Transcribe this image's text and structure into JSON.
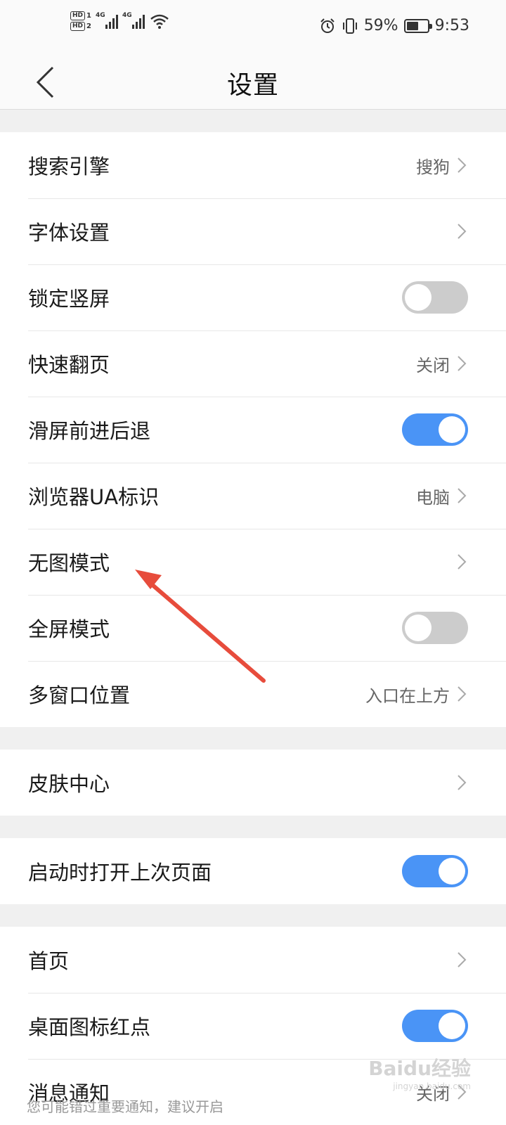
{
  "status_bar": {
    "hd1": "HD",
    "hd1_index": "1",
    "hd2": "HD",
    "hd2_index": "2",
    "network1": "4G",
    "network2": "4G",
    "battery_percent": "59%",
    "battery_level": 0.59,
    "time": "9:53",
    "icons": [
      "hd-icon",
      "signal-icon",
      "wifi-icon",
      "alarm-icon",
      "vibrate-icon",
      "battery-icon"
    ]
  },
  "nav": {
    "title": "设置",
    "back_icon": "chevron-left-icon"
  },
  "group1": [
    {
      "label": "搜索引擎",
      "type": "value",
      "value": "搜狗"
    },
    {
      "label": "字体设置",
      "type": "link"
    },
    {
      "label": "锁定竖屏",
      "type": "toggle",
      "on": false
    },
    {
      "label": "快速翻页",
      "type": "value",
      "value": "关闭"
    },
    {
      "label": "滑屏前进后退",
      "type": "toggle",
      "on": true
    },
    {
      "label": "浏览器UA标识",
      "type": "value",
      "value": "电脑"
    },
    {
      "label": "无图模式",
      "type": "link"
    },
    {
      "label": "全屏模式",
      "type": "toggle",
      "on": false
    },
    {
      "label": "多窗口位置",
      "type": "value",
      "value": "入口在上方"
    }
  ],
  "group2": [
    {
      "label": "皮肤中心",
      "type": "link"
    }
  ],
  "group3": [
    {
      "label": "启动时打开上次页面",
      "type": "toggle",
      "on": true
    }
  ],
  "group4": [
    {
      "label": "首页",
      "type": "link"
    },
    {
      "label": "桌面图标红点",
      "type": "toggle",
      "on": true
    },
    {
      "label": "消息通知",
      "type": "value",
      "value": "关闭"
    }
  ],
  "notification_subtext": "您可能错过重要通知，建议开启",
  "watermark": {
    "text": "Baidu经验",
    "sub": "jingyan.baidu.com"
  },
  "colors": {
    "toggle_on": "#4a94f6",
    "toggle_off": "#cccccc",
    "annotation_arrow": "#e74c3c"
  }
}
